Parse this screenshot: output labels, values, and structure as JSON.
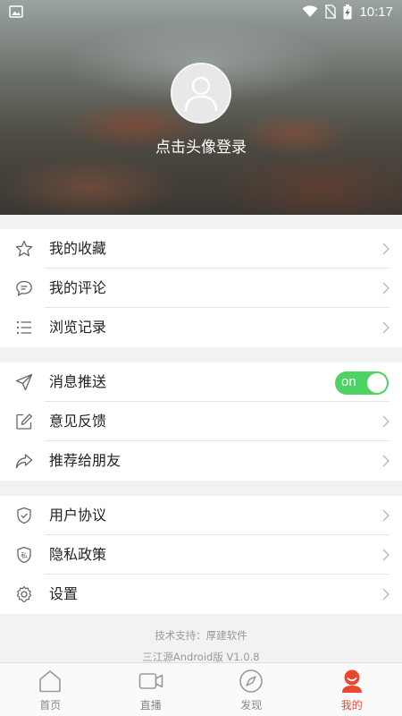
{
  "status_bar": {
    "time": "10:17"
  },
  "profile": {
    "login_prompt": "点击头像登录"
  },
  "groups": [
    {
      "items": [
        {
          "label": "我的收藏",
          "icon": "star-icon"
        },
        {
          "label": "我的评论",
          "icon": "comment-icon"
        },
        {
          "label": "浏览记录",
          "icon": "list-icon"
        }
      ]
    },
    {
      "items": [
        {
          "label": "消息推送",
          "icon": "send-icon",
          "toggle": "on"
        },
        {
          "label": "意见反馈",
          "icon": "edit-icon"
        },
        {
          "label": "推荐给朋友",
          "icon": "share-icon"
        }
      ]
    },
    {
      "items": [
        {
          "label": "用户协议",
          "icon": "shield-check-icon"
        },
        {
          "label": "隐私政策",
          "icon": "privacy-shield-icon",
          "icon_text": "私"
        },
        {
          "label": "设置",
          "icon": "gear-icon"
        }
      ]
    }
  ],
  "footer": {
    "support": "技术支持：厚建软件",
    "version": "三江源Android版 V1.0.8"
  },
  "tabs": [
    {
      "label": "首页",
      "icon": "home-icon",
      "active": false
    },
    {
      "label": "直播",
      "icon": "video-icon",
      "active": false
    },
    {
      "label": "发现",
      "icon": "compass-icon",
      "active": false
    },
    {
      "label": "我的",
      "icon": "profile-icon",
      "active": true
    }
  ],
  "colors": {
    "accent": "#e8492e",
    "toggle_on": "#4cd364"
  }
}
